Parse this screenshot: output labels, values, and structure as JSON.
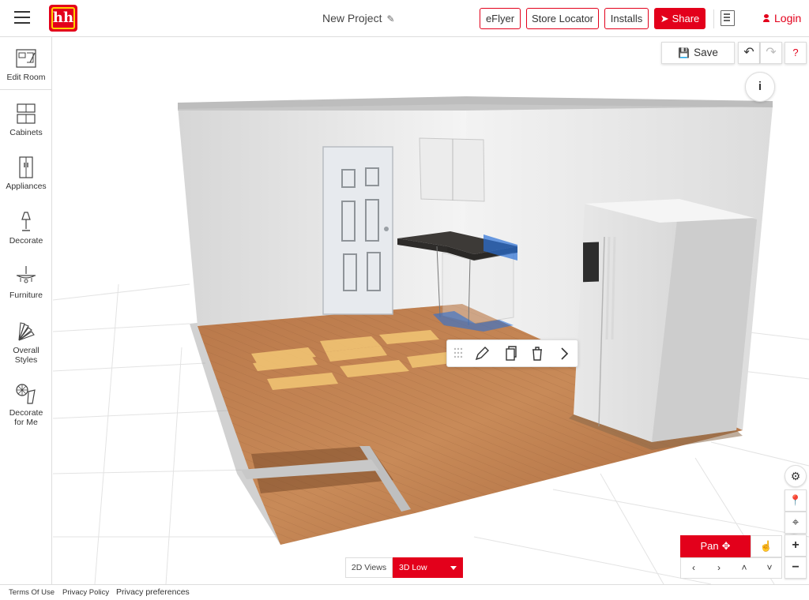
{
  "header": {
    "project_title": "New Project",
    "eflyer": "eFlyer",
    "store_locator": "Store Locator",
    "installs": "Installs",
    "share": "Share",
    "login": "Login",
    "brand_color": "#e3001b",
    "logo_text": "hh"
  },
  "sidebar": {
    "items": [
      {
        "label": "Edit Room",
        "icon": "blueprint-icon"
      },
      {
        "label": "Cabinets",
        "icon": "cabinet-icon"
      },
      {
        "label": "Appliances",
        "icon": "fridge-icon"
      },
      {
        "label": "Decorate",
        "icon": "lamp-icon"
      },
      {
        "label": "Furniture",
        "icon": "chandelier-icon"
      },
      {
        "label": "Overall Styles",
        "icon": "swatch-fan-icon"
      },
      {
        "label": "Decorate for Me",
        "icon": "decorate-for-me-icon"
      }
    ]
  },
  "toolbar": {
    "save": "Save",
    "help": "?",
    "info": "i"
  },
  "views": {
    "two_d": "2D Views",
    "three_d": "3D Low"
  },
  "nav": {
    "pan": "Pan"
  },
  "footer": {
    "terms": "Terms Of Use",
    "privacy_policy": "Privacy Policy",
    "privacy_preferences": "Privacy preferences"
  }
}
